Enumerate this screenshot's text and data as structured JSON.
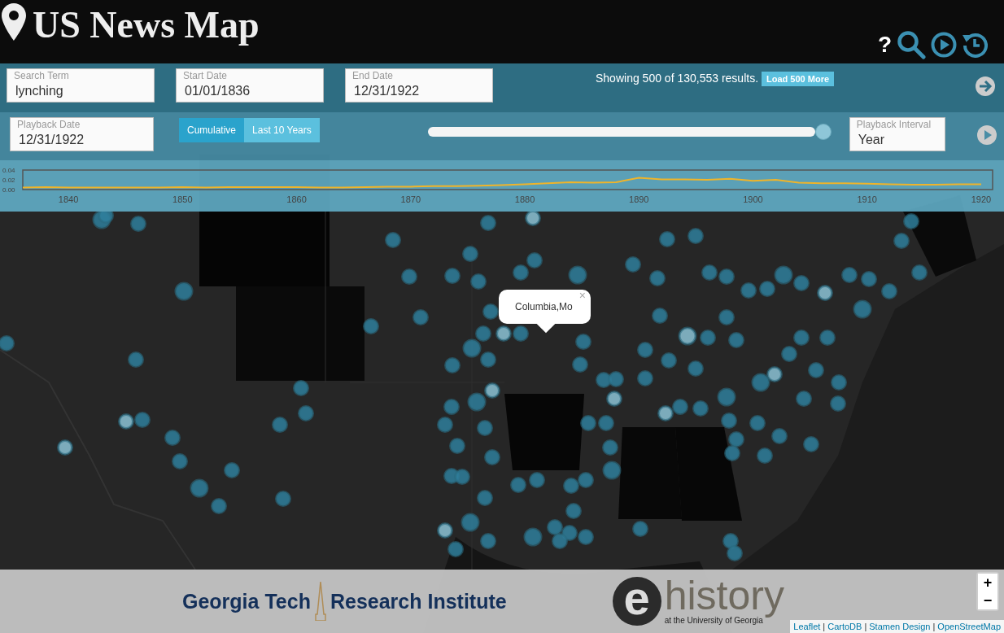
{
  "app": {
    "title": "US News Map",
    "help_label": "?"
  },
  "search": {
    "fields": [
      {
        "label": "Search Term",
        "value": "lynching"
      },
      {
        "label": "Start Date",
        "value": "01/01/1836"
      },
      {
        "label": "End Date",
        "value": "12/31/1922"
      }
    ],
    "results_text": "Showing 500 of 130,553 results.",
    "load_button": "Load 500 More"
  },
  "playback": {
    "date": {
      "label": "Playback Date",
      "value": "12/31/1922"
    },
    "modes": [
      {
        "label": "Cumulative",
        "selected": true
      },
      {
        "label": "Last 10 Years",
        "selected": false
      }
    ],
    "level": 1.0,
    "interval": {
      "label": "Playback Interval",
      "value": "Year"
    }
  },
  "timeline": {
    "chart_data": {
      "type": "line",
      "x": [
        1836,
        1838,
        1840,
        1842,
        1844,
        1846,
        1848,
        1850,
        1852,
        1854,
        1856,
        1858,
        1860,
        1862,
        1864,
        1866,
        1868,
        1870,
        1872,
        1874,
        1876,
        1878,
        1880,
        1882,
        1884,
        1886,
        1888,
        1890,
        1892,
        1894,
        1896,
        1898,
        1900,
        1902,
        1904,
        1906,
        1908,
        1910,
        1912,
        1914,
        1916,
        1918,
        1920
      ],
      "series": [
        {
          "color": "#f0b429",
          "values": [
            0.004,
            0.005,
            0.004,
            0.004,
            0.004,
            0.004,
            0.004,
            0.005,
            0.004,
            0.005,
            0.005,
            0.005,
            0.005,
            0.004,
            0.004,
            0.005,
            0.006,
            0.006,
            0.007,
            0.007,
            0.008,
            0.009,
            0.011,
            0.013,
            0.015,
            0.014,
            0.015,
            0.024,
            0.021,
            0.021,
            0.02,
            0.022,
            0.018,
            0.02,
            0.014,
            0.013,
            0.013,
            0.012,
            0.011,
            0.01,
            0.01,
            0.011,
            0.011
          ]
        }
      ],
      "xticks": [
        1840,
        1850,
        1860,
        1870,
        1880,
        1890,
        1900,
        1910,
        1920
      ],
      "yticks": [
        {
          "value": 0,
          "label": "0.00"
        },
        {
          "value": 0.02,
          "label": "0.02"
        },
        {
          "value": 0.04,
          "label": "0.04"
        }
      ],
      "xlim": [
        1836,
        1921
      ],
      "ylim": [
        0,
        0.04
      ]
    }
  },
  "map": {
    "kind": "picture",
    "popup": {
      "text": "Columbia,Mo",
      "close": "×"
    },
    "zoom": [
      "+",
      "−"
    ],
    "attribution": [
      "Leaflet",
      "CartoDB",
      "Stamen Design",
      "OpenStreetMap"
    ],
    "attribution_separator": "|"
  },
  "footer": {
    "logos": [
      {
        "kind": "gtri",
        "lines": [
          "Georgia Tech",
          "Research Institute"
        ]
      },
      {
        "kind": "ehistory",
        "mark": "e",
        "name": "history",
        "subtitle": "at the University of Georgia"
      }
    ]
  }
}
